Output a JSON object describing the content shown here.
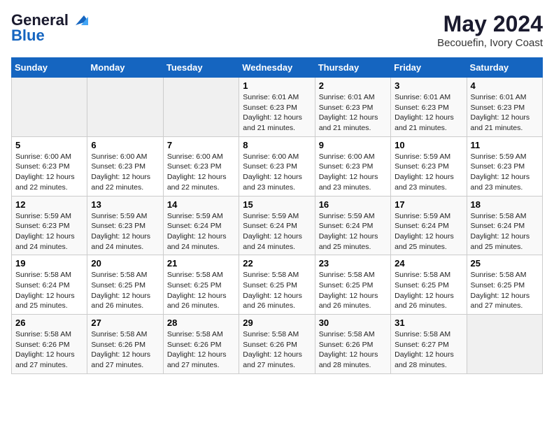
{
  "header": {
    "logo_line1": "General",
    "logo_line2": "Blue",
    "title": "May 2024",
    "subtitle": "Becouefin, Ivory Coast"
  },
  "weekdays": [
    "Sunday",
    "Monday",
    "Tuesday",
    "Wednesday",
    "Thursday",
    "Friday",
    "Saturday"
  ],
  "weeks": [
    [
      {
        "day": "",
        "info": ""
      },
      {
        "day": "",
        "info": ""
      },
      {
        "day": "",
        "info": ""
      },
      {
        "day": "1",
        "info": "Sunrise: 6:01 AM\nSunset: 6:23 PM\nDaylight: 12 hours\nand 21 minutes."
      },
      {
        "day": "2",
        "info": "Sunrise: 6:01 AM\nSunset: 6:23 PM\nDaylight: 12 hours\nand 21 minutes."
      },
      {
        "day": "3",
        "info": "Sunrise: 6:01 AM\nSunset: 6:23 PM\nDaylight: 12 hours\nand 21 minutes."
      },
      {
        "day": "4",
        "info": "Sunrise: 6:01 AM\nSunset: 6:23 PM\nDaylight: 12 hours\nand 21 minutes."
      }
    ],
    [
      {
        "day": "5",
        "info": "Sunrise: 6:00 AM\nSunset: 6:23 PM\nDaylight: 12 hours\nand 22 minutes."
      },
      {
        "day": "6",
        "info": "Sunrise: 6:00 AM\nSunset: 6:23 PM\nDaylight: 12 hours\nand 22 minutes."
      },
      {
        "day": "7",
        "info": "Sunrise: 6:00 AM\nSunset: 6:23 PM\nDaylight: 12 hours\nand 22 minutes."
      },
      {
        "day": "8",
        "info": "Sunrise: 6:00 AM\nSunset: 6:23 PM\nDaylight: 12 hours\nand 23 minutes."
      },
      {
        "day": "9",
        "info": "Sunrise: 6:00 AM\nSunset: 6:23 PM\nDaylight: 12 hours\nand 23 minutes."
      },
      {
        "day": "10",
        "info": "Sunrise: 5:59 AM\nSunset: 6:23 PM\nDaylight: 12 hours\nand 23 minutes."
      },
      {
        "day": "11",
        "info": "Sunrise: 5:59 AM\nSunset: 6:23 PM\nDaylight: 12 hours\nand 23 minutes."
      }
    ],
    [
      {
        "day": "12",
        "info": "Sunrise: 5:59 AM\nSunset: 6:23 PM\nDaylight: 12 hours\nand 24 minutes."
      },
      {
        "day": "13",
        "info": "Sunrise: 5:59 AM\nSunset: 6:23 PM\nDaylight: 12 hours\nand 24 minutes."
      },
      {
        "day": "14",
        "info": "Sunrise: 5:59 AM\nSunset: 6:24 PM\nDaylight: 12 hours\nand 24 minutes."
      },
      {
        "day": "15",
        "info": "Sunrise: 5:59 AM\nSunset: 6:24 PM\nDaylight: 12 hours\nand 24 minutes."
      },
      {
        "day": "16",
        "info": "Sunrise: 5:59 AM\nSunset: 6:24 PM\nDaylight: 12 hours\nand 25 minutes."
      },
      {
        "day": "17",
        "info": "Sunrise: 5:59 AM\nSunset: 6:24 PM\nDaylight: 12 hours\nand 25 minutes."
      },
      {
        "day": "18",
        "info": "Sunrise: 5:58 AM\nSunset: 6:24 PM\nDaylight: 12 hours\nand 25 minutes."
      }
    ],
    [
      {
        "day": "19",
        "info": "Sunrise: 5:58 AM\nSunset: 6:24 PM\nDaylight: 12 hours\nand 25 minutes."
      },
      {
        "day": "20",
        "info": "Sunrise: 5:58 AM\nSunset: 6:25 PM\nDaylight: 12 hours\nand 26 minutes."
      },
      {
        "day": "21",
        "info": "Sunrise: 5:58 AM\nSunset: 6:25 PM\nDaylight: 12 hours\nand 26 minutes."
      },
      {
        "day": "22",
        "info": "Sunrise: 5:58 AM\nSunset: 6:25 PM\nDaylight: 12 hours\nand 26 minutes."
      },
      {
        "day": "23",
        "info": "Sunrise: 5:58 AM\nSunset: 6:25 PM\nDaylight: 12 hours\nand 26 minutes."
      },
      {
        "day": "24",
        "info": "Sunrise: 5:58 AM\nSunset: 6:25 PM\nDaylight: 12 hours\nand 26 minutes."
      },
      {
        "day": "25",
        "info": "Sunrise: 5:58 AM\nSunset: 6:25 PM\nDaylight: 12 hours\nand 27 minutes."
      }
    ],
    [
      {
        "day": "26",
        "info": "Sunrise: 5:58 AM\nSunset: 6:26 PM\nDaylight: 12 hours\nand 27 minutes."
      },
      {
        "day": "27",
        "info": "Sunrise: 5:58 AM\nSunset: 6:26 PM\nDaylight: 12 hours\nand 27 minutes."
      },
      {
        "day": "28",
        "info": "Sunrise: 5:58 AM\nSunset: 6:26 PM\nDaylight: 12 hours\nand 27 minutes."
      },
      {
        "day": "29",
        "info": "Sunrise: 5:58 AM\nSunset: 6:26 PM\nDaylight: 12 hours\nand 27 minutes."
      },
      {
        "day": "30",
        "info": "Sunrise: 5:58 AM\nSunset: 6:26 PM\nDaylight: 12 hours\nand 28 minutes."
      },
      {
        "day": "31",
        "info": "Sunrise: 5:58 AM\nSunset: 6:27 PM\nDaylight: 12 hours\nand 28 minutes."
      },
      {
        "day": "",
        "info": ""
      }
    ]
  ]
}
